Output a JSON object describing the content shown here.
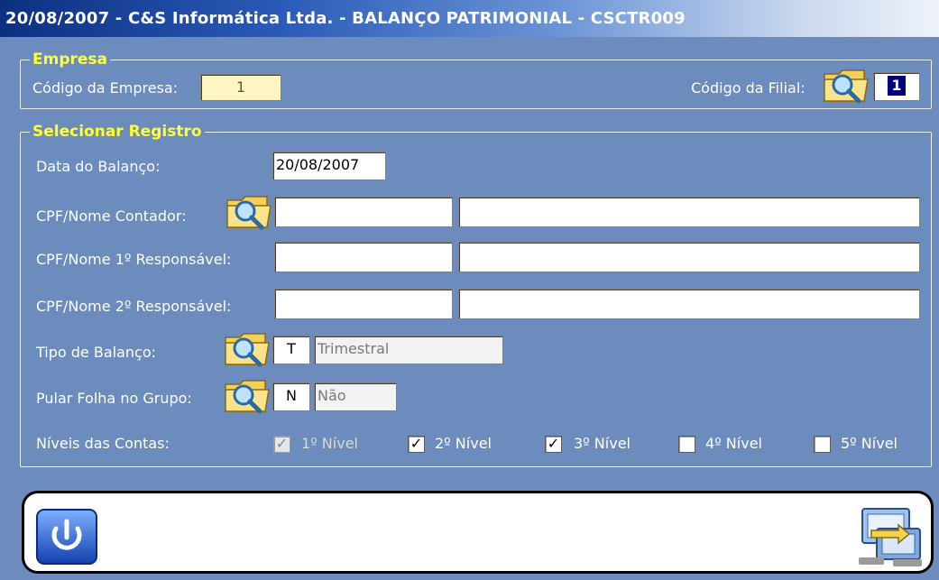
{
  "window": {
    "title": "20/08/2007  -  C&S Informática Ltda.  -  BALANÇO PATRIMONIAL  -  CSCTR009"
  },
  "empresa": {
    "legend": "Empresa",
    "codigo_empresa_label": "Código da Empresa:",
    "codigo_empresa_value": "1",
    "codigo_filial_label": "Código da Filial:",
    "codigo_filial_value": "1"
  },
  "registro": {
    "legend": "Selecionar Registro",
    "data_balanco_label": "Data do Balanço:",
    "data_balanco_value": "20/08/2007",
    "contador_label": "CPF/Nome Contador:",
    "contador_cpf": "",
    "contador_nome": "",
    "resp1_label": "CPF/Nome 1º Responsável:",
    "resp1_cpf": "",
    "resp1_nome": "",
    "resp2_label": "CPF/Nome 2º Responsável:",
    "resp2_cpf": "",
    "resp2_nome": "",
    "tipo_label": "Tipo de Balanço:",
    "tipo_code": "T",
    "tipo_desc": "Trimestral",
    "pular_label": "Pular Folha no Grupo:",
    "pular_code": "N",
    "pular_desc": "Não",
    "niveis_label": "Níveis das Contas:",
    "niveis": [
      {
        "label": "1º Nível",
        "checked": true,
        "enabled": false
      },
      {
        "label": "2º Nível",
        "checked": true,
        "enabled": true
      },
      {
        "label": "3º Nível",
        "checked": true,
        "enabled": true
      },
      {
        "label": "4º Nível",
        "checked": false,
        "enabled": true
      },
      {
        "label": "5º Nível",
        "checked": false,
        "enabled": true
      }
    ]
  },
  "colors": {
    "background": "#6b8cbd",
    "legend": "#ffff33",
    "titlebar": "#0d2f80"
  },
  "icons": {
    "search": "folder-magnifier-icon",
    "exit": "power-icon",
    "process": "exchange-icon"
  }
}
